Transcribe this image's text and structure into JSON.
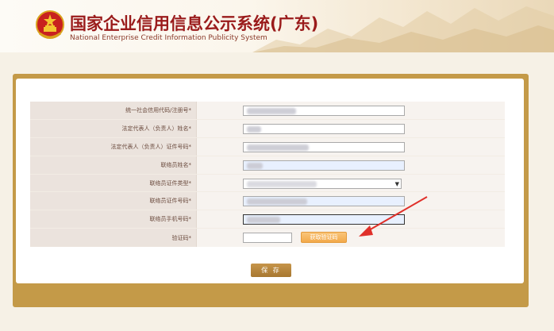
{
  "header": {
    "title_cn": "国家企业信用信息公示系统(广东)",
    "title_en": "National Enterprise Credit Information Publicity System"
  },
  "form": {
    "rows": [
      {
        "label": "统一社会信用代码/注册号*",
        "type": "text"
      },
      {
        "label": "法定代表人（负责人）姓名*",
        "type": "text"
      },
      {
        "label": "法定代表人（负责人）证件号码*",
        "type": "text"
      },
      {
        "label": "联络员姓名*",
        "type": "text-filled"
      },
      {
        "label": "联络员证件类型*",
        "type": "select"
      },
      {
        "label": "联络员证件号码*",
        "type": "text-filled"
      },
      {
        "label": "联络员手机号码*",
        "type": "text-filled-focus"
      },
      {
        "label": "验证码*",
        "type": "captcha"
      }
    ],
    "captcha_button": "获取验证码",
    "save_button": "保 存"
  },
  "colors": {
    "title": "#9a1b1b",
    "frame": "#c49a48",
    "label_bg": "#ebe3dd",
    "captcha_button": "#f3a94a",
    "save_button": "#b0823a",
    "annotation_arrow": "#e0302a"
  }
}
